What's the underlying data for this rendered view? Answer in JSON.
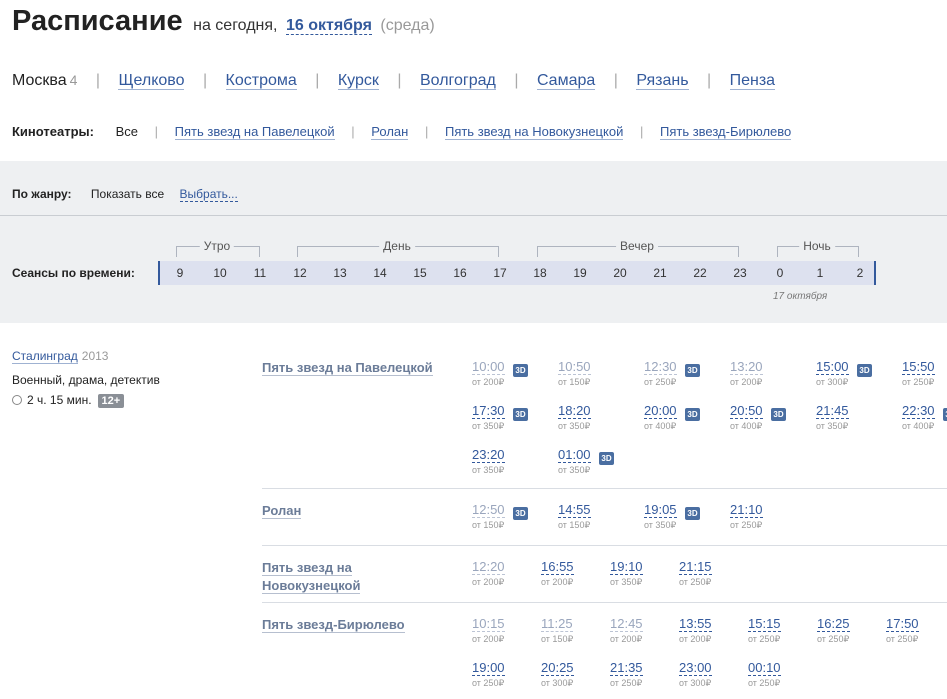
{
  "header": {
    "title": "Расписание",
    "subtitle": "на сегодня,",
    "date": "16 октября",
    "weekday": "(среда)"
  },
  "cities": {
    "current": "Москва",
    "current_count": "4",
    "items": [
      "Щелково",
      "Кострома",
      "Курск",
      "Волгоград",
      "Самара",
      "Рязань",
      "Пенза"
    ]
  },
  "cinemas_filter": {
    "label": "Кинотеатры:",
    "all": "Все",
    "items": [
      "Пять звезд на Павелецкой",
      "Ролан",
      "Пять звезд на Новокузнецкой",
      "Пять звезд-Бирюлево"
    ]
  },
  "genre_filter": {
    "label": "По жанру:",
    "show_all": "Показать все",
    "choose": "Выбрать..."
  },
  "time_filter": {
    "label": "Сеансы по времени:",
    "hours": [
      "9",
      "10",
      "11",
      "12",
      "13",
      "14",
      "15",
      "16",
      "17",
      "18",
      "19",
      "20",
      "21",
      "22",
      "23",
      "0",
      "1",
      "2"
    ],
    "periods": [
      "Утро",
      "День",
      "Вечер",
      "Ночь"
    ],
    "next_day": "17 октября"
  },
  "movie": {
    "title": "Сталинград",
    "year": "2013",
    "genres": "Военный, драма, детектив",
    "duration": "2 ч. 15 мин.",
    "age": "12+"
  },
  "schedule": [
    {
      "cinema": "Пять звезд на Павелецкой",
      "sessions": [
        {
          "time": "10:00",
          "price": "от 200₽",
          "is3d": true,
          "past": true
        },
        {
          "time": "10:50",
          "price": "от 150₽",
          "is3d": false,
          "past": true
        },
        {
          "time": "12:30",
          "price": "от 250₽",
          "is3d": true,
          "past": true
        },
        {
          "time": "13:20",
          "price": "от 200₽",
          "is3d": false,
          "past": true
        },
        {
          "time": "15:00",
          "price": "от 300₽",
          "is3d": true,
          "past": false
        },
        {
          "time": "15:50",
          "price": "от 250₽",
          "is3d": false,
          "past": false
        },
        {
          "time": "17:30",
          "price": "от 350₽",
          "is3d": true,
          "past": false
        },
        {
          "time": "18:20",
          "price": "от 350₽",
          "is3d": false,
          "past": false
        },
        {
          "time": "20:00",
          "price": "от 400₽",
          "is3d": true,
          "past": false
        },
        {
          "time": "20:50",
          "price": "от 400₽",
          "is3d": true,
          "past": false
        },
        {
          "time": "21:45",
          "price": "от 350₽",
          "is3d": false,
          "past": false
        },
        {
          "time": "22:30",
          "price": "от 400₽",
          "is3d": true,
          "past": false
        },
        {
          "time": "23:20",
          "price": "от 350₽",
          "is3d": false,
          "past": false
        },
        {
          "time": "01:00",
          "price": "от 350₽",
          "is3d": true,
          "past": false
        }
      ]
    },
    {
      "cinema": "Ролан",
      "sessions": [
        {
          "time": "12:50",
          "price": "от 150₽",
          "is3d": true,
          "past": true
        },
        {
          "time": "14:55",
          "price": "от 150₽",
          "is3d": false,
          "past": false
        },
        {
          "time": "19:05",
          "price": "от 350₽",
          "is3d": true,
          "past": false
        },
        {
          "time": "21:10",
          "price": "от 250₽",
          "is3d": false,
          "past": false
        }
      ]
    },
    {
      "cinema": "Пять звезд на Новокузнецкой",
      "sessions": [
        {
          "time": "12:20",
          "price": "от 200₽",
          "is3d": false,
          "past": true
        },
        {
          "time": "16:55",
          "price": "от 200₽",
          "is3d": false,
          "past": false
        },
        {
          "time": "19:10",
          "price": "от 350₽",
          "is3d": false,
          "past": false
        },
        {
          "time": "21:15",
          "price": "от 250₽",
          "is3d": false,
          "past": false
        }
      ]
    },
    {
      "cinema": "Пять звезд-Бирюлево",
      "sessions": [
        {
          "time": "10:15",
          "price": "от 200₽",
          "is3d": false,
          "past": true
        },
        {
          "time": "11:25",
          "price": "от 150₽",
          "is3d": false,
          "past": true
        },
        {
          "time": "12:45",
          "price": "от 200₽",
          "is3d": false,
          "past": true
        },
        {
          "time": "13:55",
          "price": "от 200₽",
          "is3d": false,
          "past": false
        },
        {
          "time": "15:15",
          "price": "от 250₽",
          "is3d": false,
          "past": false
        },
        {
          "time": "16:25",
          "price": "от 250₽",
          "is3d": false,
          "past": false
        },
        {
          "time": "17:50",
          "price": "от 250₽",
          "is3d": false,
          "past": false
        },
        {
          "time": "19:00",
          "price": "от 250₽",
          "is3d": false,
          "past": false
        },
        {
          "time": "20:25",
          "price": "от 300₽",
          "is3d": false,
          "past": false
        },
        {
          "time": "21:35",
          "price": "от 250₽",
          "is3d": false,
          "past": false
        },
        {
          "time": "23:00",
          "price": "от 300₽",
          "is3d": false,
          "past": false
        },
        {
          "time": "00:10",
          "price": "от 250₽",
          "is3d": false,
          "past": false
        }
      ]
    }
  ],
  "badge_3d": "3D"
}
